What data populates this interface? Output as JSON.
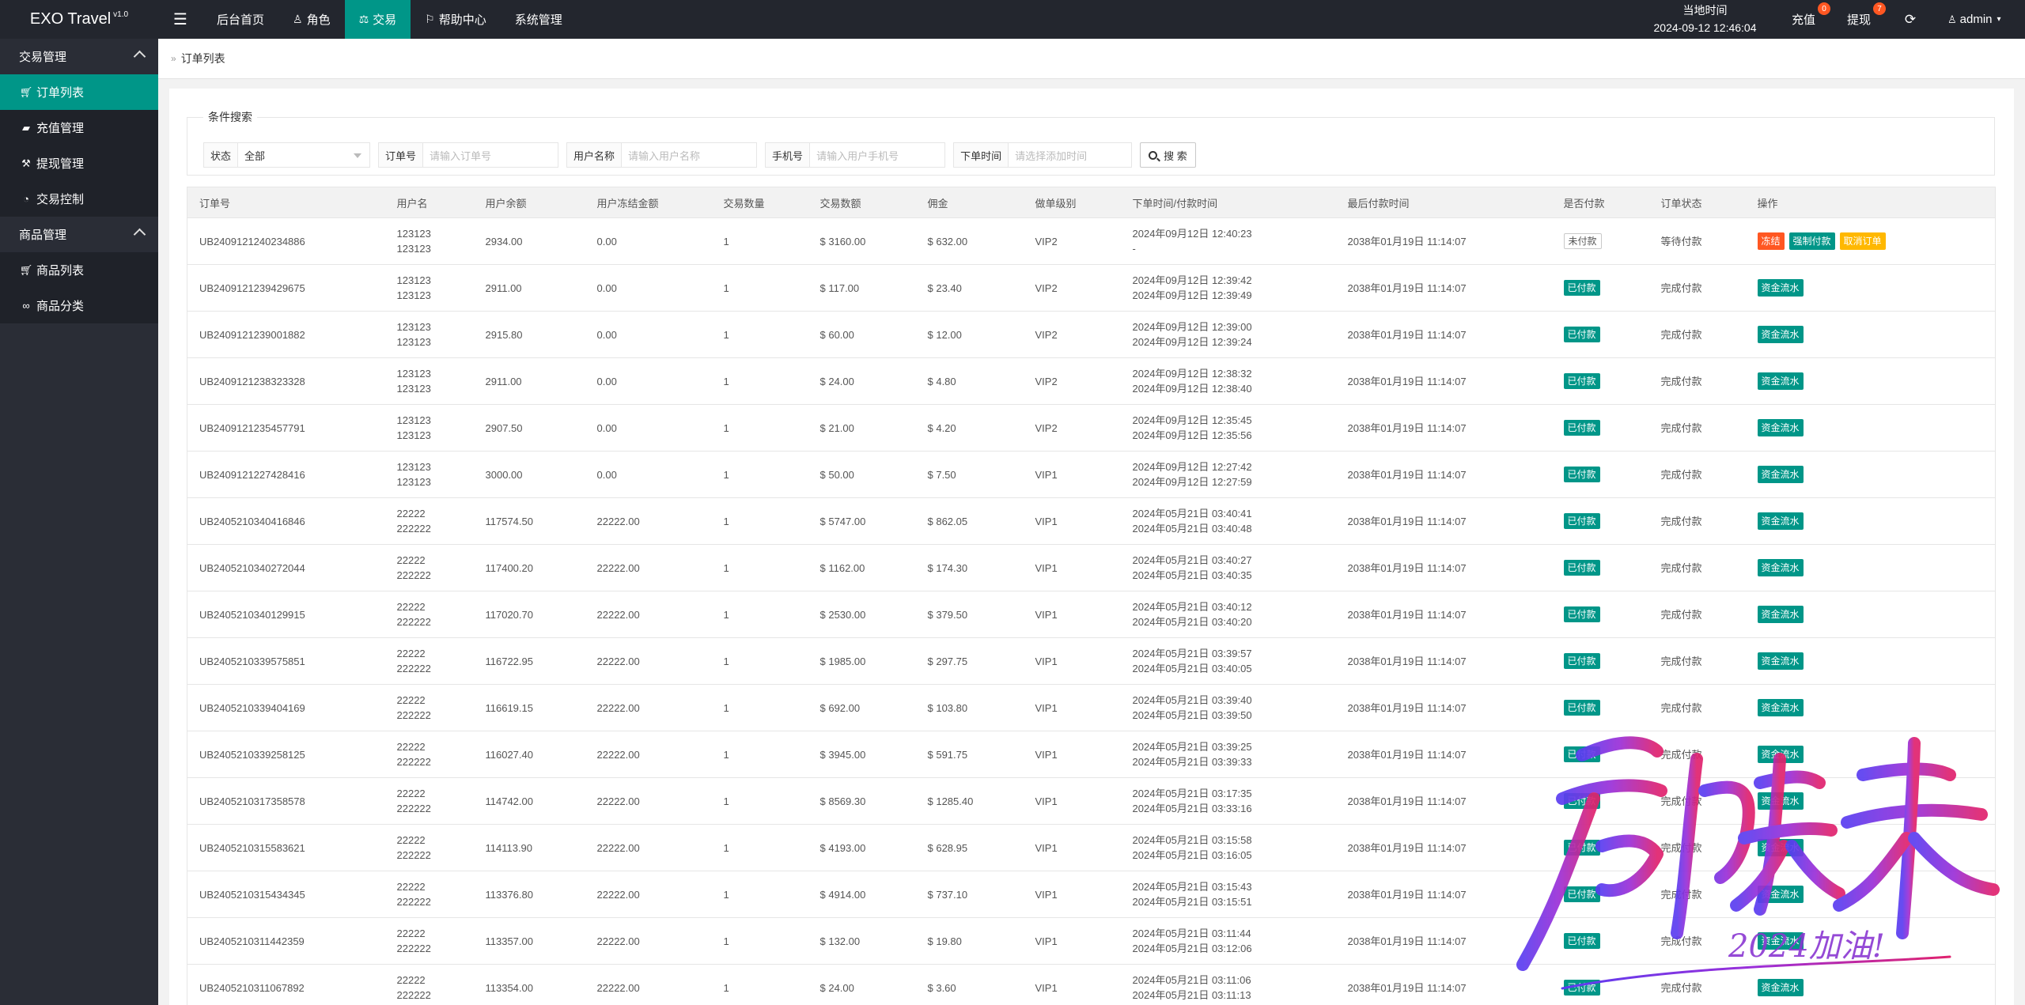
{
  "app": {
    "title": "EXO Travel",
    "version": "v1.0"
  },
  "topnav": [
    {
      "label": "后台首页",
      "icon": ""
    },
    {
      "label": "角色",
      "icon": "user-icon"
    },
    {
      "label": "交易",
      "icon": "scale-icon",
      "active": true
    },
    {
      "label": "帮助中心",
      "icon": "flag-icon"
    },
    {
      "label": "系统管理",
      "icon": ""
    }
  ],
  "header": {
    "clock_label": "当地时间",
    "clock_value": "2024-09-12 12:46:04",
    "recharge_label": "充值",
    "recharge_badge": "0",
    "withdraw_label": "提现",
    "withdraw_badge": "7",
    "user": "admin"
  },
  "sidebar": {
    "groups": [
      {
        "label": "交易管理",
        "items": [
          {
            "label": "订单列表",
            "icon": "cart-icon",
            "active": true
          },
          {
            "label": "充值管理",
            "icon": "chat-icon"
          },
          {
            "label": "提现管理",
            "icon": "hammer-icon"
          },
          {
            "label": "交易控制",
            "icon": "gauge-icon"
          }
        ]
      },
      {
        "label": "商品管理",
        "items": [
          {
            "label": "商品列表",
            "icon": "cart-icon"
          },
          {
            "label": "商品分类",
            "icon": "link-icon"
          }
        ]
      }
    ]
  },
  "breadcrumb": {
    "label": "订单列表"
  },
  "search": {
    "legend": "条件搜索",
    "status_label": "状态",
    "status_value": "全部",
    "order_label": "订单号",
    "order_placeholder": "请输入订单号",
    "username_label": "用户名称",
    "username_placeholder": "请输入用户名称",
    "phone_label": "手机号",
    "phone_placeholder": "请输入用户手机号",
    "time_label": "下单时间",
    "time_placeholder": "请选择添加时间",
    "button_label": "搜 索"
  },
  "table": {
    "columns": [
      "订单号",
      "用户名",
      "用户余额",
      "用户冻结金额",
      "交易数量",
      "交易数额",
      "佣金",
      "做单级别",
      "下单时间/付款时间",
      "最后付款时间",
      "是否付款",
      "订单状态",
      "操作"
    ],
    "rows": [
      {
        "order": "UB2409121240234886",
        "user1": "123123",
        "user2": "123123",
        "balance": "2934.00",
        "frozen": "0.00",
        "qty": "1",
        "amount": "$ 3160.00",
        "commission": "$ 632.00",
        "level": "VIP2",
        "t1": "2024年09月12日 12:40:23",
        "t2": "-",
        "last": "2038年01月19日 11:14:07",
        "paid": "未付款",
        "status": "等待付款",
        "actions": [
          "冻结",
          "强制付款",
          "取消订单"
        ]
      },
      {
        "order": "UB2409121239429675",
        "user1": "123123",
        "user2": "123123",
        "balance": "2911.00",
        "frozen": "0.00",
        "qty": "1",
        "amount": "$ 117.00",
        "commission": "$ 23.40",
        "level": "VIP2",
        "t1": "2024年09月12日 12:39:42",
        "t2": "2024年09月12日 12:39:49",
        "last": "2038年01月19日 11:14:07",
        "paid": "已付款",
        "status": "完成付款",
        "actions": [
          "资金流水"
        ]
      },
      {
        "order": "UB2409121239001882",
        "user1": "123123",
        "user2": "123123",
        "balance": "2915.80",
        "frozen": "0.00",
        "qty": "1",
        "amount": "$ 60.00",
        "commission": "$ 12.00",
        "level": "VIP2",
        "t1": "2024年09月12日 12:39:00",
        "t2": "2024年09月12日 12:39:24",
        "last": "2038年01月19日 11:14:07",
        "paid": "已付款",
        "status": "完成付款",
        "actions": [
          "资金流水"
        ]
      },
      {
        "order": "UB2409121238323328",
        "user1": "123123",
        "user2": "123123",
        "balance": "2911.00",
        "frozen": "0.00",
        "qty": "1",
        "amount": "$ 24.00",
        "commission": "$ 4.80",
        "level": "VIP2",
        "t1": "2024年09月12日 12:38:32",
        "t2": "2024年09月12日 12:38:40",
        "last": "2038年01月19日 11:14:07",
        "paid": "已付款",
        "status": "完成付款",
        "actions": [
          "资金流水"
        ]
      },
      {
        "order": "UB2409121235457791",
        "user1": "123123",
        "user2": "123123",
        "balance": "2907.50",
        "frozen": "0.00",
        "qty": "1",
        "amount": "$ 21.00",
        "commission": "$ 4.20",
        "level": "VIP2",
        "t1": "2024年09月12日 12:35:45",
        "t2": "2024年09月12日 12:35:56",
        "last": "2038年01月19日 11:14:07",
        "paid": "已付款",
        "status": "完成付款",
        "actions": [
          "资金流水"
        ]
      },
      {
        "order": "UB2409121227428416",
        "user1": "123123",
        "user2": "123123",
        "balance": "3000.00",
        "frozen": "0.00",
        "qty": "1",
        "amount": "$ 50.00",
        "commission": "$ 7.50",
        "level": "VIP1",
        "t1": "2024年09月12日 12:27:42",
        "t2": "2024年09月12日 12:27:59",
        "last": "2038年01月19日 11:14:07",
        "paid": "已付款",
        "status": "完成付款",
        "actions": [
          "资金流水"
        ]
      },
      {
        "order": "UB2405210340416846",
        "user1": "22222",
        "user2": "222222",
        "balance": "117574.50",
        "frozen": "22222.00",
        "qty": "1",
        "amount": "$ 5747.00",
        "commission": "$ 862.05",
        "level": "VIP1",
        "t1": "2024年05月21日 03:40:41",
        "t2": "2024年05月21日 03:40:48",
        "last": "2038年01月19日 11:14:07",
        "paid": "已付款",
        "status": "完成付款",
        "actions": [
          "资金流水"
        ]
      },
      {
        "order": "UB2405210340272044",
        "user1": "22222",
        "user2": "222222",
        "balance": "117400.20",
        "frozen": "22222.00",
        "qty": "1",
        "amount": "$ 1162.00",
        "commission": "$ 174.30",
        "level": "VIP1",
        "t1": "2024年05月21日 03:40:27",
        "t2": "2024年05月21日 03:40:35",
        "last": "2038年01月19日 11:14:07",
        "paid": "已付款",
        "status": "完成付款",
        "actions": [
          "资金流水"
        ]
      },
      {
        "order": "UB2405210340129915",
        "user1": "22222",
        "user2": "222222",
        "balance": "117020.70",
        "frozen": "22222.00",
        "qty": "1",
        "amount": "$ 2530.00",
        "commission": "$ 379.50",
        "level": "VIP1",
        "t1": "2024年05月21日 03:40:12",
        "t2": "2024年05月21日 03:40:20",
        "last": "2038年01月19日 11:14:07",
        "paid": "已付款",
        "status": "完成付款",
        "actions": [
          "资金流水"
        ]
      },
      {
        "order": "UB2405210339575851",
        "user1": "22222",
        "user2": "222222",
        "balance": "116722.95",
        "frozen": "22222.00",
        "qty": "1",
        "amount": "$ 1985.00",
        "commission": "$ 297.75",
        "level": "VIP1",
        "t1": "2024年05月21日 03:39:57",
        "t2": "2024年05月21日 03:40:05",
        "last": "2038年01月19日 11:14:07",
        "paid": "已付款",
        "status": "完成付款",
        "actions": [
          "资金流水"
        ]
      },
      {
        "order": "UB2405210339404169",
        "user1": "22222",
        "user2": "222222",
        "balance": "116619.15",
        "frozen": "22222.00",
        "qty": "1",
        "amount": "$ 692.00",
        "commission": "$ 103.80",
        "level": "VIP1",
        "t1": "2024年05月21日 03:39:40",
        "t2": "2024年05月21日 03:39:50",
        "last": "2038年01月19日 11:14:07",
        "paid": "已付款",
        "status": "完成付款",
        "actions": [
          "资金流水"
        ]
      },
      {
        "order": "UB2405210339258125",
        "user1": "22222",
        "user2": "222222",
        "balance": "116027.40",
        "frozen": "22222.00",
        "qty": "1",
        "amount": "$ 3945.00",
        "commission": "$ 591.75",
        "level": "VIP1",
        "t1": "2024年05月21日 03:39:25",
        "t2": "2024年05月21日 03:39:33",
        "last": "2038年01月19日 11:14:07",
        "paid": "已付款",
        "status": "完成付款",
        "actions": [
          "资金流水"
        ]
      },
      {
        "order": "UB2405210317358578",
        "user1": "22222",
        "user2": "222222",
        "balance": "114742.00",
        "frozen": "22222.00",
        "qty": "1",
        "amount": "$ 8569.30",
        "commission": "$ 1285.40",
        "level": "VIP1",
        "t1": "2024年05月21日 03:17:35",
        "t2": "2024年05月21日 03:33:16",
        "last": "2038年01月19日 11:14:07",
        "paid": "已付款",
        "status": "完成付款",
        "actions": [
          "资金流水"
        ]
      },
      {
        "order": "UB2405210315583621",
        "user1": "22222",
        "user2": "222222",
        "balance": "114113.90",
        "frozen": "22222.00",
        "qty": "1",
        "amount": "$ 4193.00",
        "commission": "$ 628.95",
        "level": "VIP1",
        "t1": "2024年05月21日 03:15:58",
        "t2": "2024年05月21日 03:16:05",
        "last": "2038年01月19日 11:14:07",
        "paid": "已付款",
        "status": "完成付款",
        "actions": [
          "资金流水"
        ]
      },
      {
        "order": "UB2405210315434345",
        "user1": "22222",
        "user2": "222222",
        "balance": "113376.80",
        "frozen": "22222.00",
        "qty": "1",
        "amount": "$ 4914.00",
        "commission": "$ 737.10",
        "level": "VIP1",
        "t1": "2024年05月21日 03:15:43",
        "t2": "2024年05月21日 03:15:51",
        "last": "2038年01月19日 11:14:07",
        "paid": "已付款",
        "status": "完成付款",
        "actions": [
          "资金流水"
        ]
      },
      {
        "order": "UB2405210311442359",
        "user1": "22222",
        "user2": "222222",
        "balance": "113357.00",
        "frozen": "22222.00",
        "qty": "1",
        "amount": "$ 132.00",
        "commission": "$ 19.80",
        "level": "VIP1",
        "t1": "2024年05月21日 03:11:44",
        "t2": "2024年05月21日 03:12:06",
        "last": "2038年01月19日 11:14:07",
        "paid": "已付款",
        "status": "完成付款",
        "actions": [
          "资金流水"
        ]
      },
      {
        "order": "UB2405210311067892",
        "user1": "22222",
        "user2": "222222",
        "balance": "113354.00",
        "frozen": "22222.00",
        "qty": "1",
        "amount": "$ 24.00",
        "commission": "$ 3.60",
        "level": "VIP1",
        "t1": "2024年05月21日 03:11:06",
        "t2": "2024年05月21日 03:11:13",
        "last": "2038年01月19日 11:14:07",
        "paid": "已付款",
        "status": "完成付款",
        "actions": [
          "资金流水"
        ]
      }
    ]
  },
  "watermark": {
    "main": "启航未来",
    "sub": "2024加油!"
  },
  "colors": {
    "accent": "#009688",
    "danger": "#ff5722",
    "warning": "#ffb800",
    "header_bg": "#23262e",
    "sidebar_bg": "#2a2d36"
  }
}
